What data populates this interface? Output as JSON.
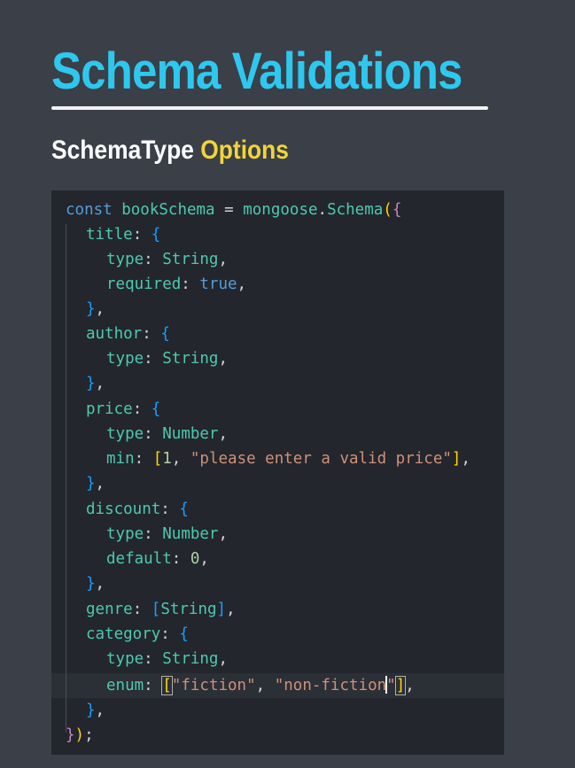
{
  "slide": {
    "title": "Schema Validations",
    "subtitle_part1": "SchemaType ",
    "subtitle_part2": "Options"
  },
  "code": {
    "lines": [
      "const bookSchema = mongoose.Schema({",
      "  title: {",
      "    type: String,",
      "    required: true,",
      "  },",
      "  author: {",
      "    type: String,",
      "  },",
      "  price: {",
      "    type: Number,",
      "    min: [1, \"please enter a valid price\"],",
      "  },",
      "  discount: {",
      "    type: Number,",
      "    default: 0,",
      "  },",
      "  genre: [String],",
      "  category: {",
      "    type: String,",
      "    enum: [\"fiction\", \"non-fiction\"],",
      "  },",
      "});"
    ],
    "colors": {
      "keyword": "#569cd6",
      "variable": "#4ec9b0",
      "string": "#ce9178",
      "bracket_level1": "#ffd700",
      "bracket_level2": "#c586c0",
      "bracket_level3": "#179fff"
    },
    "cursor_line": 20
  }
}
